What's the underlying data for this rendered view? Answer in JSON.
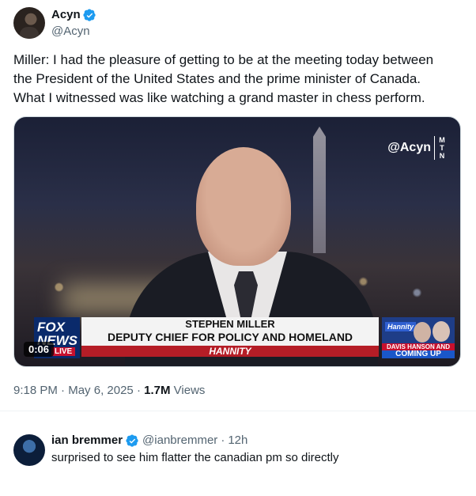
{
  "tweet": {
    "author": {
      "display_name": "Acyn",
      "handle": "@Acyn",
      "verified": true
    },
    "text_lines": [
      "Miller: I had the pleasure of getting to be at the meeting today between",
      "the President of the United States and the prime minister of Canada.",
      "What I witnessed was like watching a grand master in chess perform."
    ],
    "video": {
      "watermark": "@Acyn",
      "watermark_mtn": "M T N",
      "duration": "0:06",
      "network_logo_top": "FOX",
      "network_logo_bottom": "NEWS",
      "network_live": "LIVE",
      "chyron_name": "STEPHEN MILLER",
      "chyron_title": "DEPUTY CHIEF FOR POLICY AND HOMELAND SECURITY ADVISOR",
      "show_name": "HANNITY",
      "promo_tag": "Hannity",
      "promo_names": "DAVIS HANSON AND PRIEBUS",
      "promo_coming": "COMING UP"
    },
    "time": "9:18 PM",
    "separator": "·",
    "date": "May 6, 2025",
    "views_count": "1.7M",
    "views_label": "Views"
  },
  "reply": {
    "display_name": "ian bremmer",
    "verified": true,
    "handle": "@ianbremmer",
    "separator": "·",
    "age": "12h",
    "text": "surprised to see him flatter the canadian pm so directly"
  },
  "colors": {
    "verified_blue": "#1d9bf0",
    "secondary_text": "#536471",
    "primary_text": "#0f1419"
  }
}
